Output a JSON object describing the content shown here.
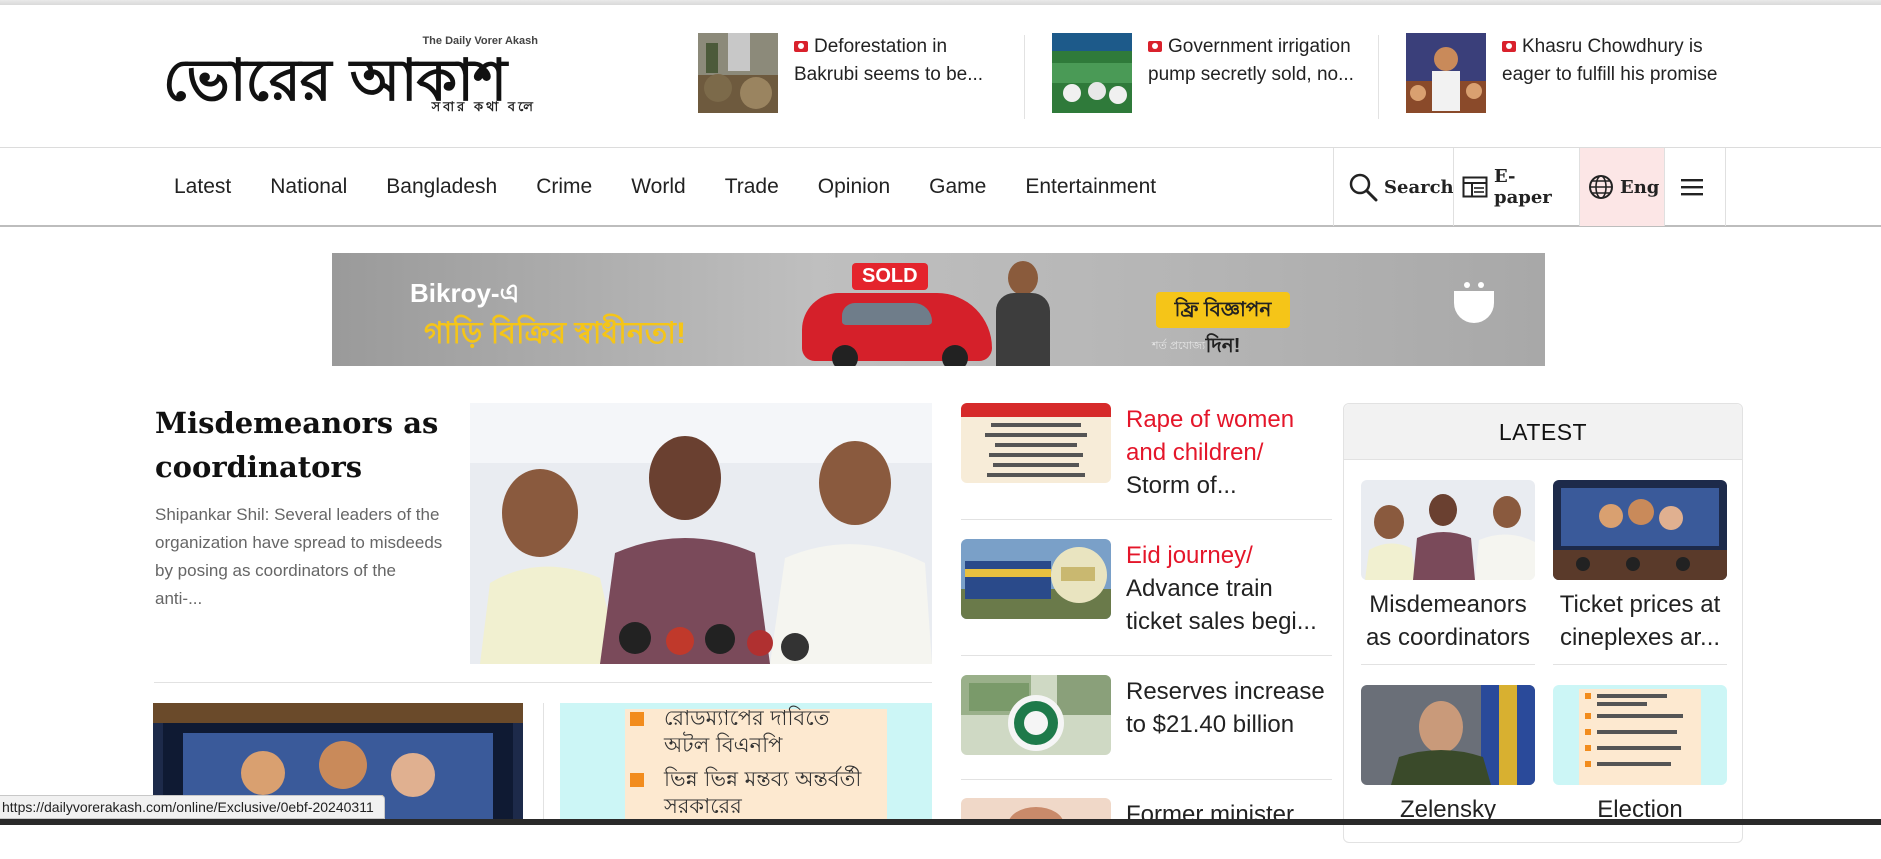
{
  "site": {
    "logo_tagline_top": "The Daily Vorer Akash",
    "logo_text": "ভোরের আকাশ",
    "logo_tagline_bottom": "সবার কথা বলে"
  },
  "top_headlines": [
    {
      "text": "Deforestation in Bakrubi seems to be..."
    },
    {
      "text": "Government irrigation pump secretly sold, no..."
    },
    {
      "text": "Khasru Chowdhury is eager to fulfill his promise"
    }
  ],
  "nav": {
    "items": [
      "Latest",
      "National",
      "Bangladesh",
      "Crime",
      "World",
      "Trade",
      "Opinion",
      "Game",
      "Entertainment"
    ],
    "search_label": "Search",
    "epaper_label": "E-paper",
    "lang_label": "Eng"
  },
  "ad": {
    "brand": "Bikroy-এ",
    "slogan": "গাড়ি বিক্রির স্বাধীনতা!",
    "sold": "SOLD",
    "cta": "ফ্রি বিজ্ঞাপন দিন!",
    "sub": "শর্ত প্রযোজ্য"
  },
  "lead": {
    "title": "Misdemeanors as coordinators",
    "summary": "Shipankar Shil: Several leaders of the organization have spread to misdeeds by posing as coordinators of the anti-..."
  },
  "sub_card2": {
    "line1": "রোডম্যাপের দাবিতে",
    "line2": "অটল বিএনপি",
    "line3": "ভিন্ন ভিন্ন মন্তব্য অন্তর্বর্তী",
    "line4": "সরকারের"
  },
  "middle": [
    {
      "tag": "Rape of women and children/",
      "text": "Storm of..."
    },
    {
      "tag": "Eid journey/",
      "text": "Advance train ticket sales begi..."
    },
    {
      "tag": "",
      "text": "Reserves increase to $21.40 billion"
    },
    {
      "tag": "",
      "text": "Former minister"
    }
  ],
  "latest": {
    "heading": "LATEST",
    "items": [
      {
        "text": "Misdemeanors as coordinators"
      },
      {
        "text": "Ticket prices at cineplexes ar..."
      },
      {
        "text": "Zelensky"
      },
      {
        "text": "Election"
      }
    ]
  },
  "status_url": "https://dailyvorerakash.com/online/Exclusive/0ebf-20240311",
  "colors": {
    "accent_red": "#e4162a",
    "lang_bg": "#fce6e6"
  }
}
